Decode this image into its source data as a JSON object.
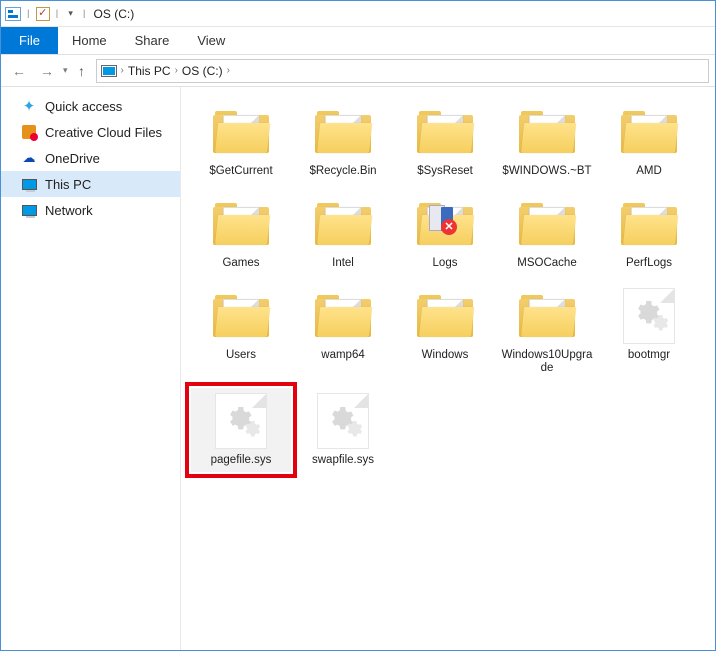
{
  "titlebar": {
    "title": "OS (C:)"
  },
  "ribbon": {
    "file": "File",
    "tabs": [
      "Home",
      "Share",
      "View"
    ]
  },
  "breadcrumb": {
    "items": [
      "This PC",
      "OS (C:)"
    ]
  },
  "sidebar": {
    "items": [
      {
        "label": "Quick access",
        "icon": "star"
      },
      {
        "label": "Creative Cloud Files",
        "icon": "creative-cloud"
      },
      {
        "label": "OneDrive",
        "icon": "onedrive"
      },
      {
        "label": "This PC",
        "icon": "this-pc",
        "selected": true
      },
      {
        "label": "Network",
        "icon": "network"
      }
    ]
  },
  "items": [
    {
      "name": "$GetCurrent",
      "type": "folder"
    },
    {
      "name": "$Recycle.Bin",
      "type": "folder"
    },
    {
      "name": "$SysReset",
      "type": "folder"
    },
    {
      "name": "$WINDOWS.~BT",
      "type": "folder"
    },
    {
      "name": "AMD",
      "type": "folder"
    },
    {
      "name": "Games",
      "type": "folder"
    },
    {
      "name": "Intel",
      "type": "folder"
    },
    {
      "name": "Logs",
      "type": "folder-logs"
    },
    {
      "name": "MSOCache",
      "type": "folder"
    },
    {
      "name": "PerfLogs",
      "type": "folder"
    },
    {
      "name": "Users",
      "type": "folder"
    },
    {
      "name": "wamp64",
      "type": "folder"
    },
    {
      "name": "Windows",
      "type": "folder"
    },
    {
      "name": "Windows10Upgrade",
      "type": "folder"
    },
    {
      "name": "bootmgr",
      "type": "sysfile"
    },
    {
      "name": "pagefile.sys",
      "type": "sysfile",
      "highlighted": true
    },
    {
      "name": "swapfile.sys",
      "type": "sysfile"
    }
  ]
}
